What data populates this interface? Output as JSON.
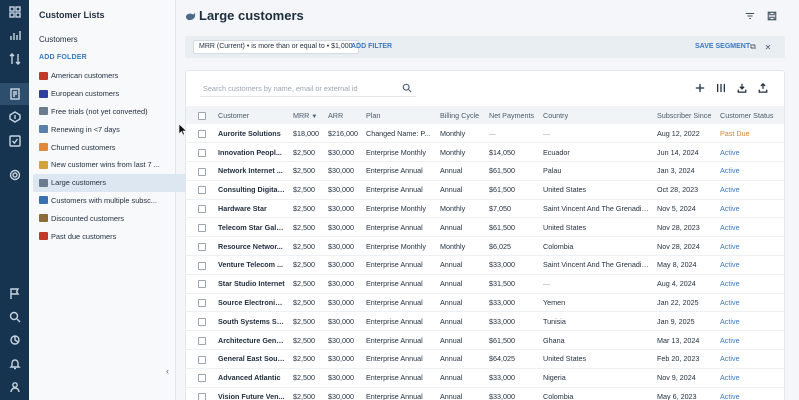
{
  "sidebar": {
    "title": "Customer Lists",
    "customers_link": "Customers",
    "add_folder": "ADD FOLDER",
    "items": [
      {
        "label": "American customers",
        "color": "#c0392b"
      },
      {
        "label": "European customers",
        "color": "#2c3e9e"
      },
      {
        "label": "Free trials (not yet converted)",
        "color": "#6b7c8c"
      },
      {
        "label": "Renewing in <7 days",
        "color": "#5a7fa8"
      },
      {
        "label": "Churned customers",
        "color": "#e0893a"
      },
      {
        "label": "New customer wins from last 7 ...",
        "color": "#d4a23a"
      },
      {
        "label": "Large customers",
        "color": "#6b7c8c"
      },
      {
        "label": "Customers with multiple subsc...",
        "color": "#3a6fb0"
      },
      {
        "label": "Discounted customers",
        "color": "#8b6d3a"
      },
      {
        "label": "Past due customers",
        "color": "#c0392b"
      }
    ],
    "active_index": 6
  },
  "header": {
    "title": "Large customers"
  },
  "filter": {
    "chip": "MRR (Current) • is more than or equal to • $1,000",
    "add_filter": "ADD FILTER",
    "save_segment": "SAVE SEGMENT"
  },
  "search": {
    "placeholder": "Search customers by name, email or external id"
  },
  "table": {
    "columns": [
      "Customer",
      "MRR",
      "ARR",
      "Plan",
      "Billing Cycle",
      "Net Payments",
      "Country",
      "Subscriber Since",
      "Customer Status"
    ],
    "rows": [
      [
        "Aurorite Solutions",
        "$18,000",
        "$216,000",
        "Changed Name: P...",
        "Monthly",
        "—",
        "—",
        "Aug 12, 2022",
        "Past Due"
      ],
      [
        "Innovation Peopl...",
        "$2,500",
        "$30,000",
        "Enterprise Monthly",
        "Monthly",
        "$14,050",
        "Ecuador",
        "Jun 14, 2024",
        "Active"
      ],
      [
        "Network Internet ...",
        "$2,500",
        "$30,000",
        "Enterprise Annual",
        "Annual",
        "$61,500",
        "Palau",
        "Jan 3, 2024",
        "Active"
      ],
      [
        "Consulting Digital...",
        "$2,500",
        "$30,000",
        "Enterprise Annual",
        "Annual",
        "$61,500",
        "United States",
        "Oct 28, 2023",
        "Active"
      ],
      [
        "Hardware Star",
        "$2,500",
        "$30,000",
        "Enterprise Monthly",
        "Monthly",
        "$7,050",
        "Saint Vincent And The Grenadines",
        "Nov 5, 2024",
        "Active"
      ],
      [
        "Telecom Star Galaxy",
        "$2,500",
        "$30,000",
        "Enterprise Annual",
        "Annual",
        "$61,500",
        "United States",
        "Nov 28, 2023",
        "Active"
      ],
      [
        "Resource Networ...",
        "$2,500",
        "$30,000",
        "Enterprise Monthly",
        "Monthly",
        "$6,025",
        "Colombia",
        "Nov 28, 2024",
        "Active"
      ],
      [
        "Venture Telecom ...",
        "$2,500",
        "$30,000",
        "Enterprise Annual",
        "Annual",
        "$33,000",
        "Saint Vincent And The Grenadines",
        "May 8, 2024",
        "Active"
      ],
      [
        "Star Studio Internet",
        "$2,500",
        "$30,000",
        "Enterprise Annual",
        "Annual",
        "$31,500",
        "—",
        "Aug 4, 2024",
        "Active"
      ],
      [
        "Source Electronic...",
        "$2,500",
        "$30,000",
        "Enterprise Annual",
        "Annual",
        "$33,000",
        "Yemen",
        "Jan 22, 2025",
        "Active"
      ],
      [
        "South Systems Star",
        "$2,500",
        "$30,000",
        "Enterprise Annual",
        "Annual",
        "$33,000",
        "Tunisia",
        "Jan 9, 2025",
        "Active"
      ],
      [
        "Architecture Gene...",
        "$2,500",
        "$30,000",
        "Enterprise Annual",
        "Annual",
        "$61,500",
        "Ghana",
        "Mar 13, 2024",
        "Active"
      ],
      [
        "General East Source",
        "$2,500",
        "$30,000",
        "Enterprise Annual",
        "Annual",
        "$64,025",
        "United States",
        "Feb 20, 2023",
        "Active"
      ],
      [
        "Advanced Atlantic",
        "$2,500",
        "$30,000",
        "Enterprise Annual",
        "Annual",
        "$33,000",
        "Nigeria",
        "Nov 9, 2024",
        "Active"
      ],
      [
        "Vision Future Ven...",
        "$2,500",
        "$30,000",
        "Enterprise Annual",
        "Annual",
        "$33,000",
        "Colombia",
        "May 6, 2023",
        "Active"
      ]
    ]
  }
}
